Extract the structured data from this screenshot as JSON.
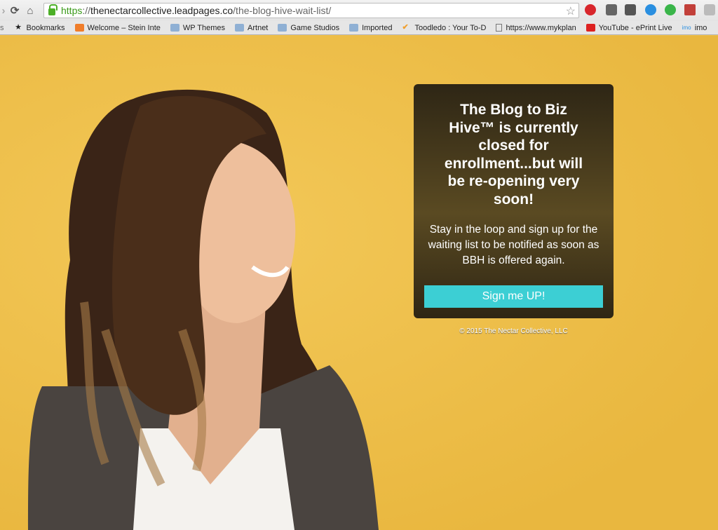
{
  "browser": {
    "url_scheme": "https",
    "url_sep": "://",
    "url_host": "thenectarcollective.leadpages.co",
    "url_path": "/the-blog-hive-wait-list/",
    "extensions": [
      "pinterest-icon",
      "pocket-icon",
      "evernote-icon",
      "vpn-icon",
      "hangouts-icon",
      "book-icon",
      "ghostery-icon"
    ],
    "bookmarks": [
      {
        "label": "Bookmarks",
        "icon": "star-icon"
      },
      {
        "label": "Welcome – Stein Inte",
        "icon": "h-icon"
      },
      {
        "label": "WP Themes",
        "icon": "folder-icon"
      },
      {
        "label": "Artnet",
        "icon": "folder-icon"
      },
      {
        "label": "Game Studios",
        "icon": "folder-icon"
      },
      {
        "label": "Imported",
        "icon": "folder-icon"
      },
      {
        "label": "Toodledo : Your To-D",
        "icon": "check-icon"
      },
      {
        "label": "https://www.mykplan",
        "icon": "page-icon"
      },
      {
        "label": "YouTube - ePrint Live",
        "icon": "youtube-icon"
      },
      {
        "label": "imo",
        "icon": "imo-icon"
      }
    ]
  },
  "card": {
    "title": "The Blog to Biz Hive™ is currently closed for enrollment...but will be re-opening very soon!",
    "body": "Stay in the loop and sign up for the waiting list to be notified as soon as BBH is offered again.",
    "button": "Sign me UP!"
  },
  "footer": {
    "copyright": "© 2015 The Nectar Collective, LLC"
  },
  "colors": {
    "background": "#efc04c",
    "button": "#3ccfd4",
    "card": "#3d3219"
  }
}
